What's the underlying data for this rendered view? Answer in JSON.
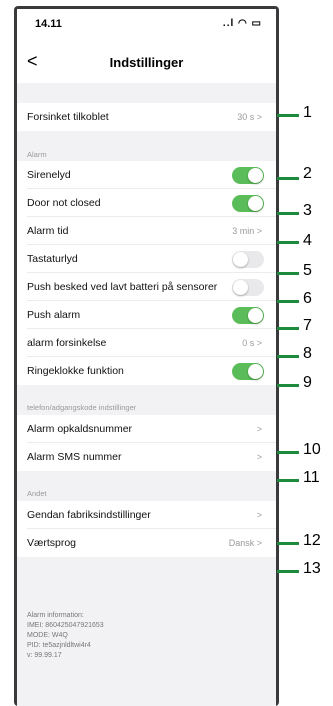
{
  "status": {
    "time": "14.11",
    "icons": "..l ◠ ▭"
  },
  "nav": {
    "back": "<",
    "title": "Indstillinger"
  },
  "rows": [
    {
      "label": "Forsinket tilkoblet",
      "value": "30 s >"
    },
    {
      "label": "Sirenelyd"
    },
    {
      "label": "Door not closed"
    },
    {
      "label": "Alarm tid",
      "value": "3 min >"
    },
    {
      "label": "Tastaturlyd"
    },
    {
      "label": "Push besked ved lavt batteri på sensorer"
    },
    {
      "label": "Push alarm"
    },
    {
      "label": "alarm forsinkelse",
      "value": "0 s >"
    },
    {
      "label": "Ringeklokke funktion"
    },
    {
      "label": "Alarm opkaldsnummer",
      "value": ">"
    },
    {
      "label": "Alarm SMS nummer",
      "value": ">"
    },
    {
      "label": "Gendan fabriksindstillinger",
      "value": ">"
    },
    {
      "label": "Værtsprog",
      "value": "Dansk >"
    }
  ],
  "toggles": {
    "sirenelyd": true,
    "door": true,
    "tastatur": false,
    "push_batteri": false,
    "push_alarm": true,
    "ringeklokke": true
  },
  "sections": {
    "alarm": "Alarm",
    "telefon": "telefon/adgangskode indstillinger",
    "andet": "Andet"
  },
  "info": [
    "Alarm information:",
    "IMEI: 860425047921653",
    "MODE: W4Q",
    "PID: te5azjnldltwi4r4",
    "v: 99.99.17"
  ],
  "callouts": [
    "1",
    "2",
    "3",
    "4",
    "5",
    "6",
    "7",
    "8",
    "9",
    "10",
    "11",
    "12",
    "13"
  ]
}
